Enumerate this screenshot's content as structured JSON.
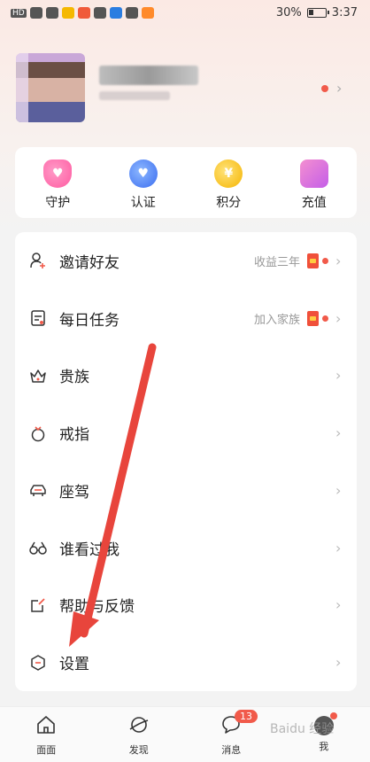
{
  "status": {
    "battery": "30%",
    "time": "3:37",
    "carrier": "HD"
  },
  "profile": {
    "name": "",
    "subtitle": ""
  },
  "quick": [
    {
      "label": "守护",
      "icon": "heart-icon"
    },
    {
      "label": "认证",
      "icon": "badge-icon"
    },
    {
      "label": "积分",
      "icon": "coin-icon"
    },
    {
      "label": "充值",
      "icon": "wallet-icon"
    }
  ],
  "menu": [
    {
      "label": "邀请好友",
      "extra": "收益三年",
      "redpack": true,
      "dot": true,
      "icon": "invite-user-icon"
    },
    {
      "label": "每日任务",
      "extra": "加入家族",
      "redpack": true,
      "dot": true,
      "icon": "task-icon"
    },
    {
      "label": "贵族",
      "extra": "",
      "icon": "crown-icon"
    },
    {
      "label": "戒指",
      "extra": "",
      "icon": "ring-icon"
    },
    {
      "label": "座驾",
      "extra": "",
      "icon": "car-icon"
    },
    {
      "label": "谁看过我",
      "extra": "",
      "icon": "glasses-icon"
    },
    {
      "label": "帮助与反馈",
      "extra": "",
      "icon": "feedback-icon"
    },
    {
      "label": "设置",
      "extra": "",
      "icon": "settings-icon"
    }
  ],
  "nav": [
    {
      "label": "面面",
      "icon": "home-icon"
    },
    {
      "label": "发现",
      "icon": "planet-icon"
    },
    {
      "label": "消息",
      "icon": "chat-icon",
      "badge": "13"
    },
    {
      "label": "我",
      "icon": "me-avatar-icon"
    }
  ],
  "watermark": "Baidu 经验",
  "colors": {
    "accent": "#f15a4a",
    "annotation_arrow": "#e8453c"
  }
}
